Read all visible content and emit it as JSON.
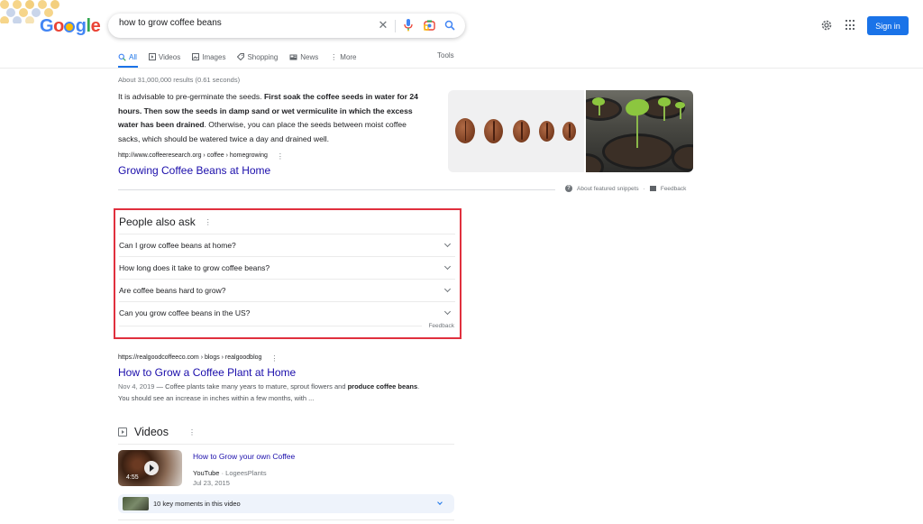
{
  "header": {
    "logo_letters": [
      "G",
      "o",
      "o",
      "g",
      "l",
      "e"
    ],
    "search_query": "how to grow coffee beans",
    "icons": [
      "clear-icon",
      "mic-icon",
      "lens-icon",
      "search-icon",
      "settings-icon",
      "apps-icon"
    ],
    "sign_in_label": "Sign in",
    "accent_color": "#1a73e8"
  },
  "tabs": {
    "items": [
      {
        "label": "All",
        "icon": "search-icon",
        "active": true
      },
      {
        "label": "Videos",
        "icon": "video-icon"
      },
      {
        "label": "Images",
        "icon": "image-icon"
      },
      {
        "label": "Shopping",
        "icon": "tag-icon"
      },
      {
        "label": "News",
        "icon": "news-icon"
      },
      {
        "label": "More",
        "icon": "more-vert-icon"
      }
    ],
    "tools_label": "Tools"
  },
  "stats": "About 31,000,000 results (0.61 seconds)",
  "featured_snippet": {
    "text_parts": [
      {
        "text": "It is advisable to pre-germinate the seeds. ",
        "bold": false
      },
      {
        "text": "First soak the coffee seeds in water for 24 hours. Then sow the seeds in damp sand or wet vermiculite in which the excess water has been drained",
        "bold": true
      },
      {
        "text": ". Otherwise, you can place the seeds between moist coffee sacks, which should be watered twice a day and drained well.",
        "bold": false
      }
    ],
    "cite": "http://www.coffeeresearch.org › coffee › homegrowing",
    "title": "Growing Coffee Beans at Home",
    "images": [
      "coffee-beans-row",
      "coffee-seedlings-in-pots"
    ],
    "about_label": "About featured snippets",
    "feedback_label": "Feedback"
  },
  "people_also_ask": {
    "title": "People also ask",
    "questions": [
      "Can I grow coffee beans at home?",
      "How long does it take to grow coffee beans?",
      "Are coffee beans hard to grow?",
      "Can you grow coffee beans in the US?"
    ],
    "feedback_label": "Feedback",
    "highlight_color": "#e0303e"
  },
  "result2": {
    "cite": "https://realgoodcoffeeco.com › blogs › realgoodblog",
    "title": "How to Grow a Coffee Plant at Home",
    "date": "Nov 4, 2019",
    "desc_parts": [
      {
        "text": " — Coffee plants take many years to mature, sprout flowers and ",
        "bold": false
      },
      {
        "text": "produce coffee beans",
        "bold": true
      },
      {
        "text": ". You should see an increase in inches within a few months, with ...",
        "bold": false
      }
    ]
  },
  "videos": {
    "heading": "Videos",
    "items": [
      {
        "title": "How to Grow your own Coffee",
        "source": "YouTube",
        "channel": "LogeesPlants",
        "date": "Jul 23, 2015",
        "duration": "4:55",
        "key_moments": "10 key moments in this video"
      }
    ]
  }
}
